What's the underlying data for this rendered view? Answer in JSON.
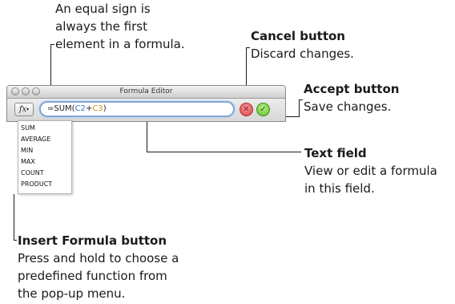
{
  "callouts": {
    "equal_sign": [
      "An equal sign is",
      "always the first",
      "element in a formula."
    ],
    "cancel": {
      "title": "Cancel button",
      "lines": [
        "Discard changes."
      ]
    },
    "accept": {
      "title": "Accept button",
      "lines": [
        "Save changes."
      ]
    },
    "text_field": {
      "title": "Text field",
      "lines": [
        "View or edit a formula",
        "in this field."
      ]
    },
    "insert_formula": {
      "title": "Insert Formula button",
      "lines": [
        "Press and hold to choose a",
        "predefined function from",
        "the pop-up menu."
      ]
    }
  },
  "window": {
    "title": "Formula Editor",
    "insert_formula_label": "fx",
    "insert_formula_arrow": "▾",
    "cancel_glyph": "✕",
    "accept_glyph": "✓"
  },
  "formula": {
    "prefix": "=SUM(",
    "ref1": "C2",
    "op": "+",
    "ref2": "C3",
    "suffix": ")"
  },
  "menu": {
    "items": [
      "SUM",
      "AVERAGE",
      "MIN",
      "MAX",
      "COUNT",
      "PRODUCT"
    ]
  },
  "colors": {
    "ref_c2": "#3a78c9",
    "ref_c3": "#e08a1c",
    "field_focus": "#7fa9d8",
    "cancel": "#d94040",
    "accept": "#5cbf2a"
  }
}
